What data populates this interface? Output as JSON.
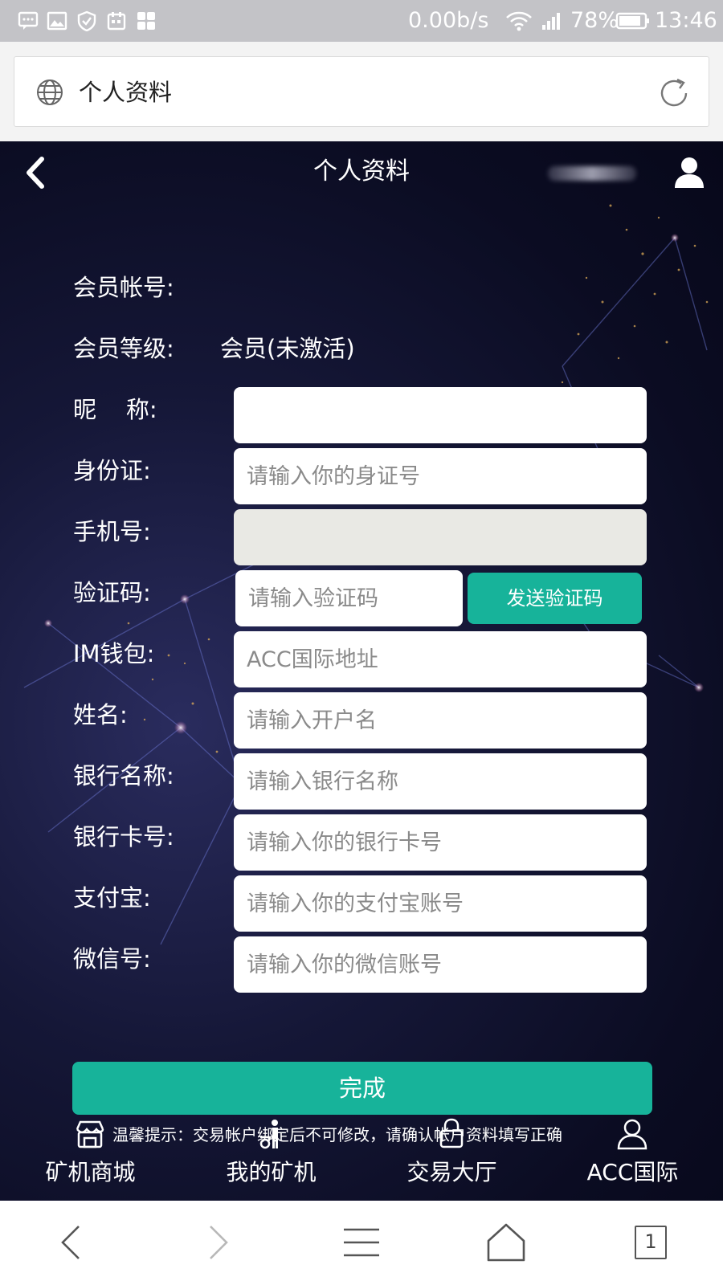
{
  "status_bar": {
    "speed": "0.00b/s",
    "battery": "78%",
    "time": "13:46",
    "icons": [
      "message-icon",
      "image-icon",
      "shield-icon",
      "calendar-icon",
      "apps-icon",
      "wifi-icon",
      "signal-icon",
      "battery-icon"
    ]
  },
  "browser": {
    "title": "个人资料",
    "tab_count": "1"
  },
  "header": {
    "title": "个人资料"
  },
  "profile": {
    "account_label": "会员帐号:",
    "level_label": "会员等级:",
    "level_value": "会员(未激活)",
    "nickname_label": "昵    称:",
    "id_label": "身份证:",
    "id_placeholder": "请输入你的身证号",
    "phone_label": "手机号:",
    "code_label": "验证码:",
    "code_placeholder": "请输入验证码",
    "send_code": "发送验证码",
    "wallet_label": "IM钱包:",
    "wallet_placeholder": "ACC国际地址",
    "name_label": "姓名:",
    "name_placeholder": "请输入开户名",
    "bank_name_label": "银行名称:",
    "bank_name_placeholder": "请输入银行名称",
    "bank_card_label": "银行卡号:",
    "bank_card_placeholder": "请输入你的银行卡号",
    "alipay_label": "支付宝:",
    "alipay_placeholder": "请输入你的支付宝账号",
    "wechat_label": "微信号:",
    "wechat_placeholder": "请输入你的微信账号",
    "submit": "完成",
    "tip": "温馨提示：交易帐户绑定后不可修改，请确认帐户资料填写正确"
  },
  "tabs": [
    {
      "label": "矿机商城",
      "icon": "store-icon"
    },
    {
      "label": "我的矿机",
      "icon": "miner-icon"
    },
    {
      "label": "交易大厅",
      "icon": "lock-icon"
    },
    {
      "label": "ACC国际",
      "icon": "user-icon"
    }
  ],
  "colors": {
    "accent": "#17b39a",
    "background": "#0b0c22",
    "status_bar": "#c3c3c7"
  }
}
